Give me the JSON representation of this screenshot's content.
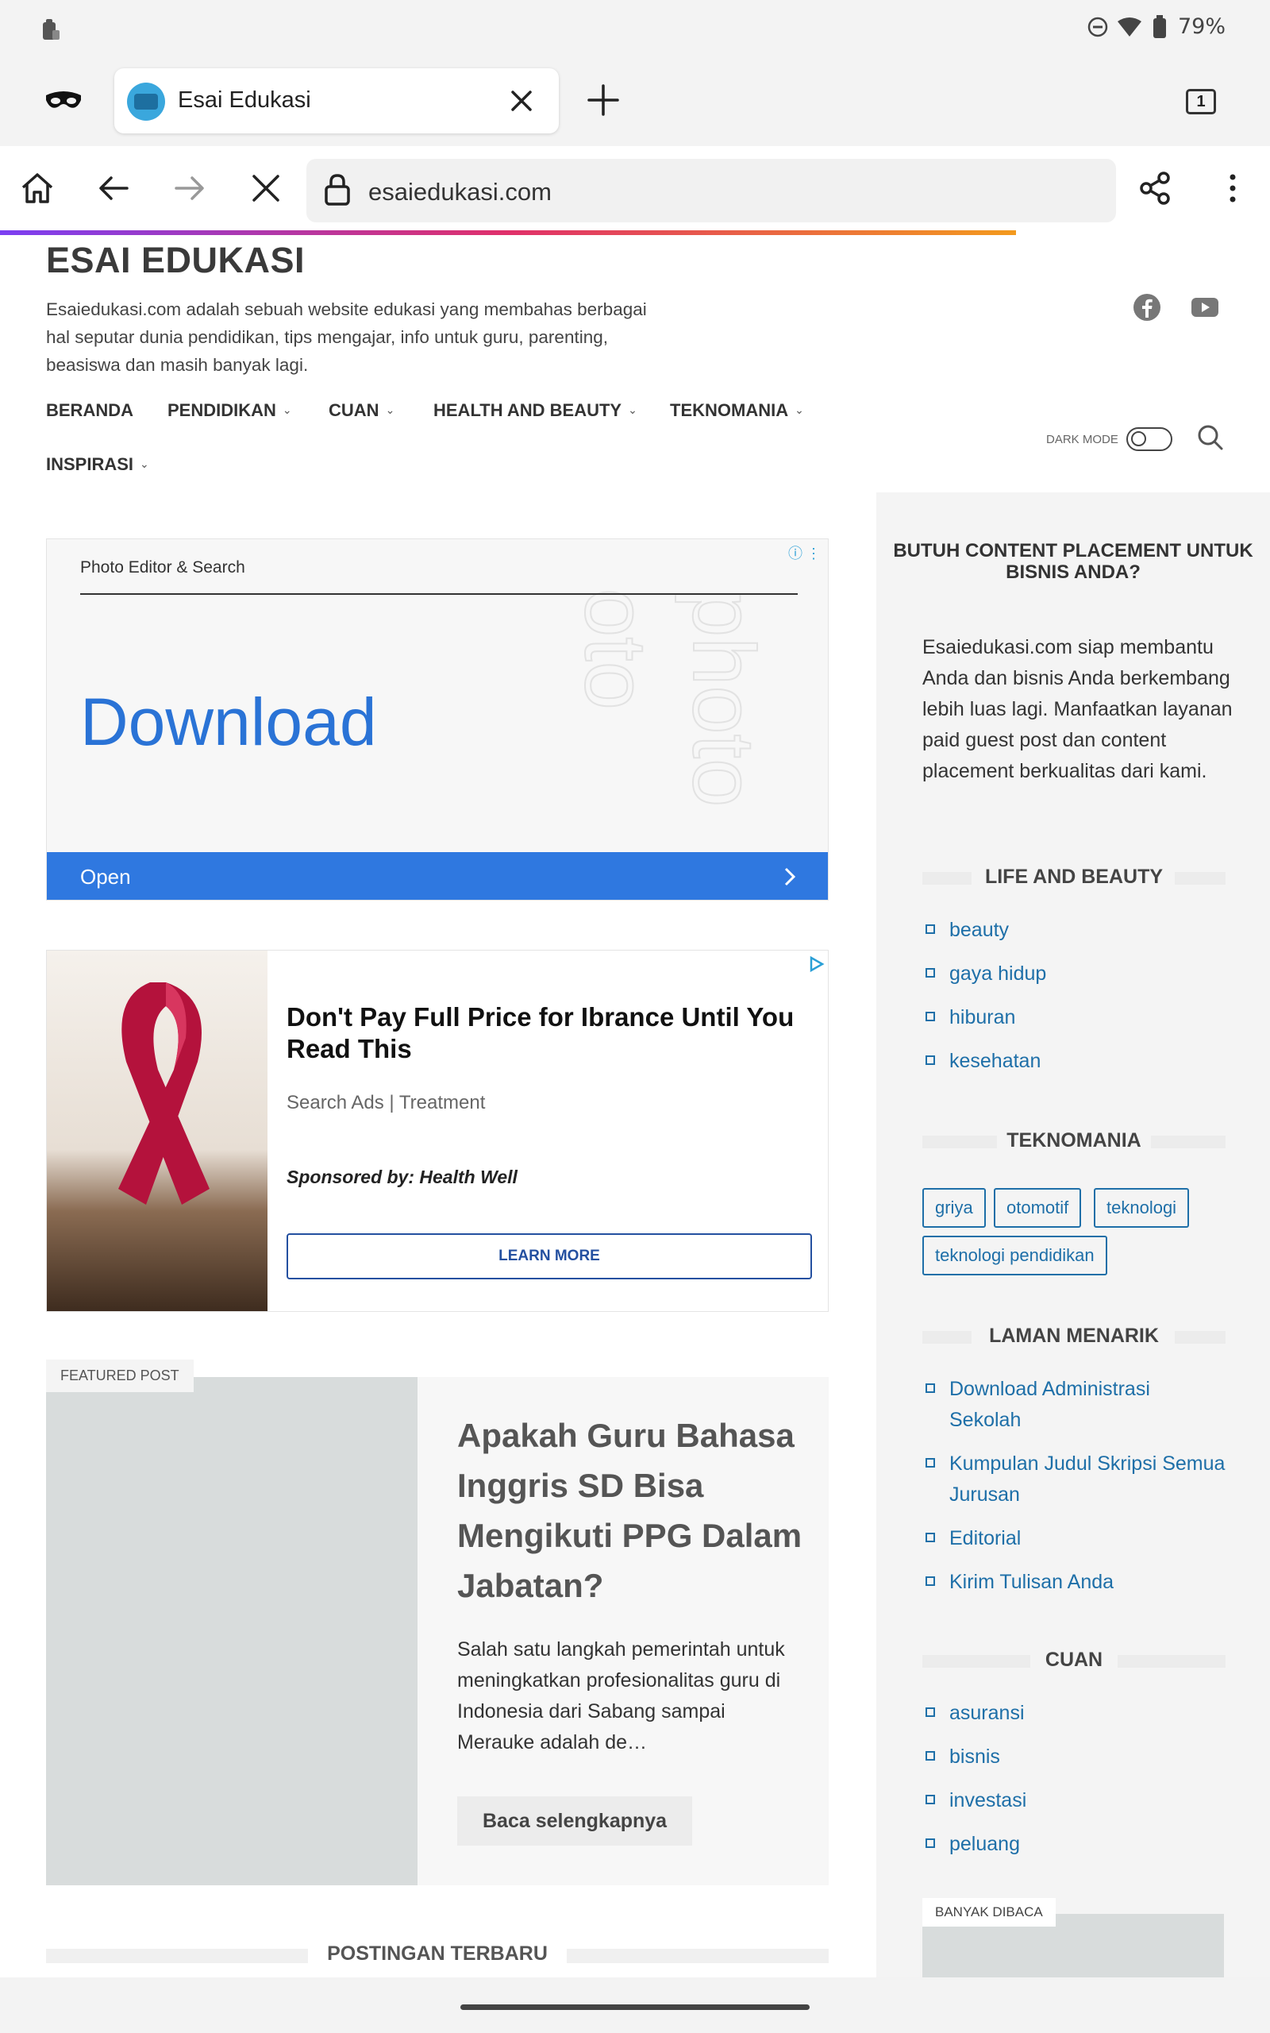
{
  "status_bar": {
    "battery": "79%",
    "icons": [
      "notification-icon",
      "dnd-icon",
      "wifi-icon",
      "battery-icon"
    ]
  },
  "browser": {
    "tab_title": "Esai Edukasi",
    "tab_count": "1",
    "url": "esaiedukasi.com",
    "icons": [
      "incognito-icon",
      "close-icon",
      "plus-icon",
      "home-icon",
      "back-icon",
      "forward-icon",
      "stop-icon",
      "lock-icon",
      "share-icon",
      "more-icon"
    ],
    "progress": 0.8
  },
  "site": {
    "title": "ESAI EDUKASI",
    "description": "Esaiedukasi.com adalah sebuah website edukasi yang membahas berbagai hal seputar dunia pendidikan, tips mengajar, info untuk guru, parenting, beasiswa dan masih banyak lagi.",
    "nav": [
      "BERANDA",
      "PENDIDIKAN",
      "CUAN",
      "HEALTH AND BEAUTY",
      "TEKNOMANIA",
      "INSPIRASI"
    ],
    "dark_mode_label": "DARK MODE"
  },
  "ads": {
    "ad1": {
      "source": "Photo Editor & Search",
      "headline": "Download",
      "button": "Open"
    },
    "ad2": {
      "headline": "Don't Pay Full Price for Ibrance Until You Read This",
      "subline": "Search Ads | Treatment",
      "sponsor": "Sponsored by: Health Well",
      "cta": "LEARN MORE"
    }
  },
  "featured": {
    "label": "FEATURED POST",
    "title": "Apakah Guru Bahasa Inggris SD Bisa Mengikuti PPG Dalam Jabatan?",
    "excerpt": "Salah satu langkah pemerintah untuk meningkatkan profesionalitas guru di Indonesia dari Sabang sampai Merauke adalah de…",
    "read_more": "Baca selengkapnya"
  },
  "recent_heading": "POSTINGAN TERBARU",
  "sidebar": {
    "cta_title": "BUTUH CONTENT PLACEMENT UNTUK BISNIS ANDA?",
    "cta_text": "Esaiedukasi.com siap membantu Anda dan bisnis Anda berkembang lebih luas lagi. Manfaatkan layanan paid guest post dan content placement berkualitas dari kami.",
    "life_heading": "LIFE AND BEAUTY",
    "life_items": [
      "beauty",
      "gaya hidup",
      "hiburan",
      "kesehatan"
    ],
    "tekno_heading": "TEKNOMANIA",
    "tekno_tags": [
      "griya",
      "otomotif",
      "teknologi",
      "teknologi pendidikan"
    ],
    "laman_heading": "LAMAN MENARIK",
    "laman_items": [
      "Download Administrasi Sekolah",
      "Kumpulan Judul Skripsi Semua Jurusan",
      "Editorial",
      "Kirim Tulisan Anda"
    ],
    "cuan_heading": "CUAN",
    "cuan_items": [
      "asuransi",
      "bisnis",
      "investasi",
      "peluang"
    ],
    "popular_label": "BANYAK DIBACA"
  }
}
